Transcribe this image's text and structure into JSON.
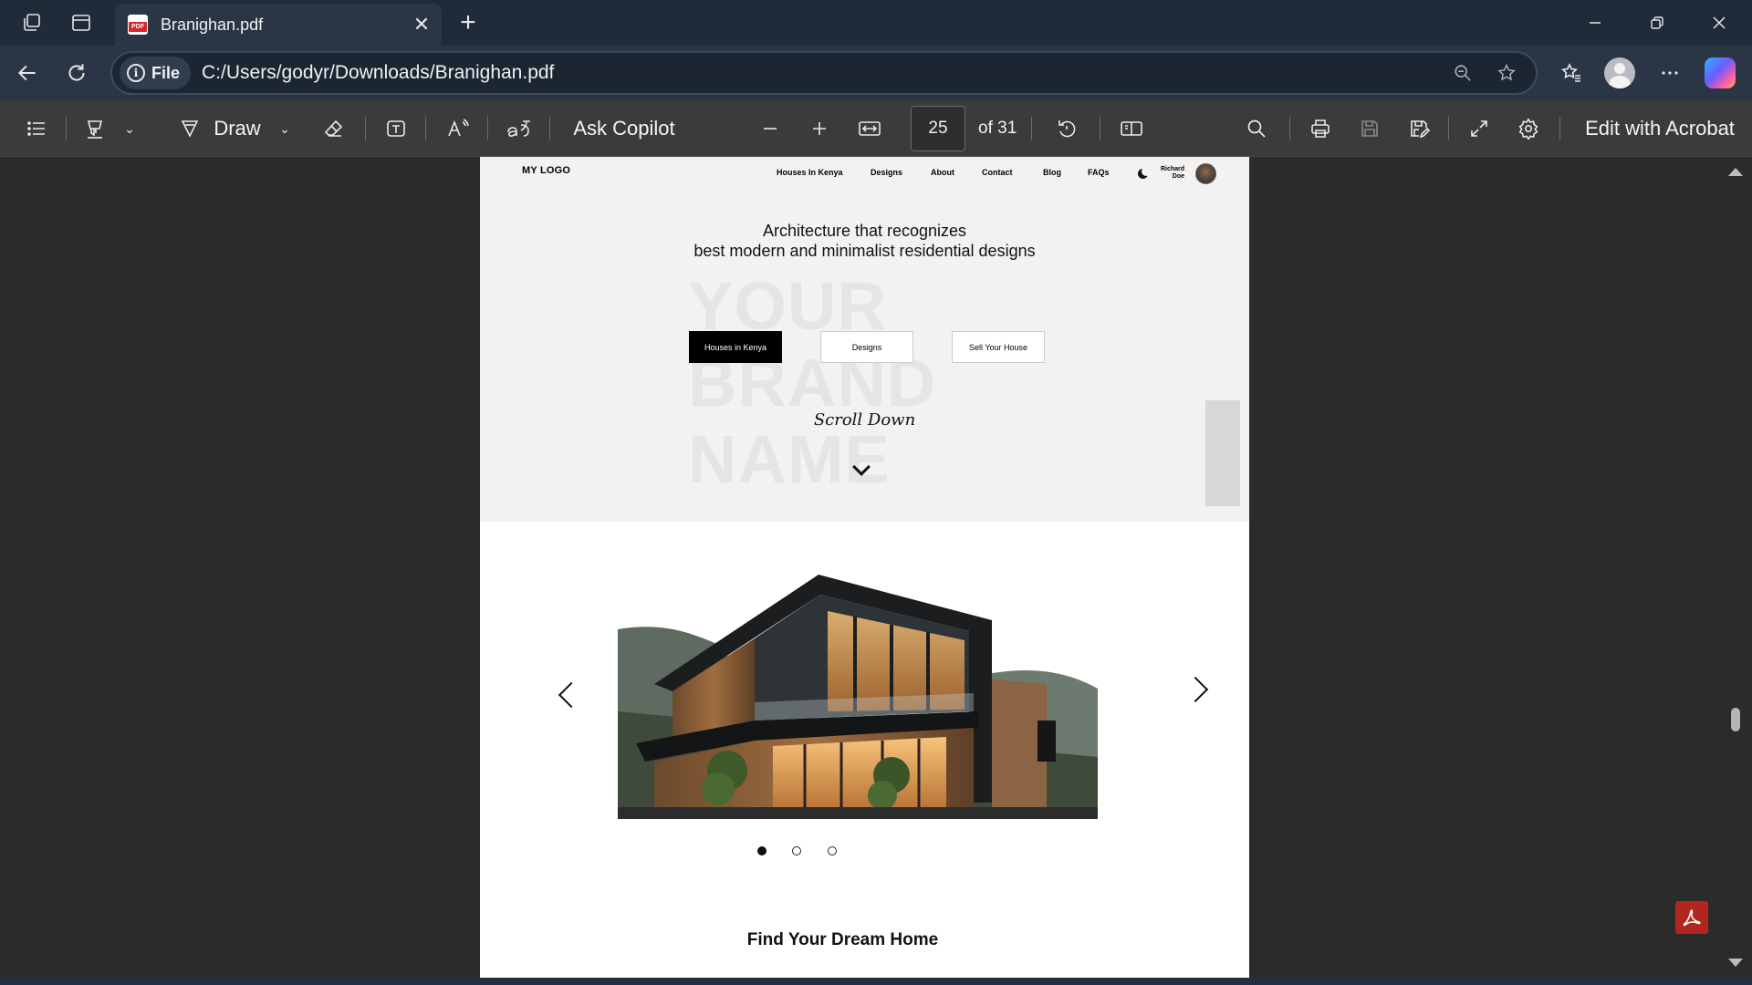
{
  "browser": {
    "tab": {
      "title": "Branighan.pdf",
      "close_glyph": "✕"
    },
    "new_tab_glyph": "+",
    "address": {
      "scheme_label": "File",
      "url": "C:/Users/godyr/Downloads/Branighan.pdf"
    },
    "window_controls": {
      "minimize": "—",
      "restore": "❐",
      "close": "✕"
    }
  },
  "pdf_toolbar": {
    "draw_label": "Draw",
    "ask_copilot_label": "Ask Copilot",
    "page_current": "25",
    "page_of": "of 31",
    "edit_label": "Edit with Acrobat"
  },
  "page": {
    "logo": "MY LOGO",
    "nav": [
      "Houses In Kenya",
      "Designs",
      "About",
      "Contact",
      "Blog",
      "FAQs"
    ],
    "user": {
      "first": "Richard",
      "last": "Doe"
    },
    "hero_line1": "Architecture that recognizes",
    "hero_line2": "best modern and minimalist residential designs",
    "watermark": [
      "YOUR",
      "BRAND",
      "NAME"
    ],
    "cta": [
      "Houses in Kenya",
      "Designs",
      "Sell Your House"
    ],
    "scroll_text": "Scroll Down",
    "section_title": "Find Your Dream Home",
    "carousel": {
      "slides": 3,
      "active": 1
    }
  },
  "icons": [
    "tab-actions-icon",
    "vertical-tabs-icon",
    "pdf-icon",
    "back-icon",
    "refresh-icon",
    "info-icon",
    "zoom-out-icon",
    "favorite-star-icon",
    "favorites-icon",
    "profile-icon",
    "more-icon",
    "copilot-icon",
    "contents-icon",
    "highlight-icon",
    "draw-icon",
    "eraser-icon",
    "text-box-icon",
    "read-aloud-icon",
    "translate-icon",
    "minus-icon",
    "plus-icon",
    "fit-width-icon",
    "rotate-icon",
    "page-view-icon",
    "search-icon",
    "print-icon",
    "save-icon",
    "save-as-icon",
    "fullscreen-icon",
    "settings-icon",
    "acrobat-icon"
  ],
  "colors": {
    "titlebar": "#1f2b38",
    "toolbar": "#3b3b3b",
    "pdf_bg": "#2b2b2b",
    "acrobat_red": "#b3261e"
  }
}
